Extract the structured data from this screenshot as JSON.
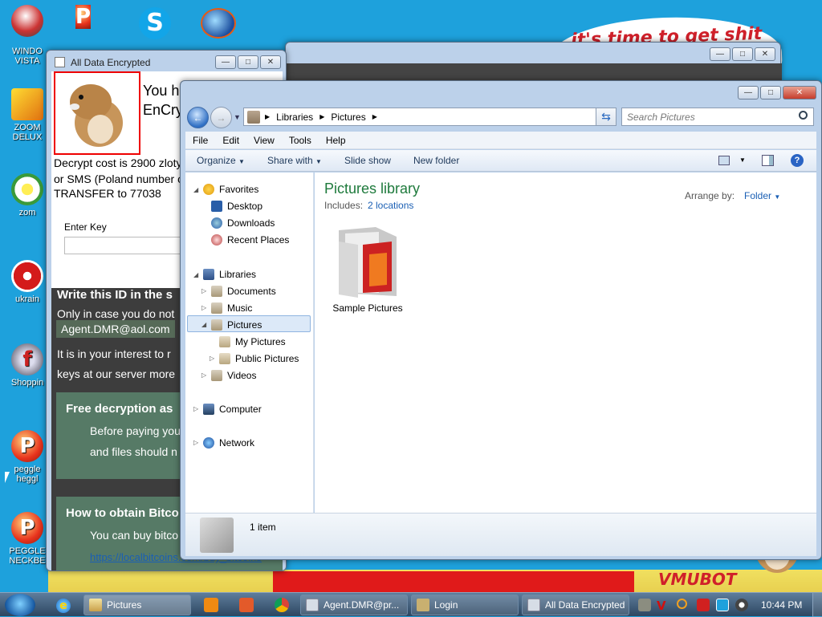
{
  "desktop": {
    "icons": [
      {
        "label": "WINDO\nVISTA"
      },
      {
        "label": "ZOOM\nDELUX"
      },
      {
        "label": "zom"
      },
      {
        "label": "ukrain"
      },
      {
        "label": "Shoppin"
      },
      {
        "label": "peggle\nheggl"
      },
      {
        "label": "PEGGLE\nNECKBE"
      }
    ],
    "wallpaper_top_text": "it's time to get shit",
    "wallpaper_bottom_text": "VMUBOT"
  },
  "ransom": {
    "title": "All Data Encrypted",
    "headline_1": "You h",
    "headline_2": "EnCry",
    "cost_line_1": "Decrypt cost is 2900 zloty",
    "cost_line_2": "or SMS (Poland number o",
    "cost_line_3": "TRANSFER to 77038",
    "key_label": "Enter Key",
    "id_heading": "Write this ID in the s",
    "only_case": "Only in case you do not",
    "email": "Agent.DMR@aol.com",
    "interest_1": "It is in your interest to r",
    "interest_2": "keys at our server more",
    "free_heading": "Free decryption as",
    "free_text_1": "Before paying you",
    "free_text_2": "and files should n",
    "bitcoin_heading": "How to obtain Bitco",
    "bitcoin_text": "You can buy bitco",
    "bitcoin_link": "https://localbitcoins.com/buy_bitcoins"
  },
  "explorer": {
    "breadcrumb": [
      "Libraries",
      "Pictures"
    ],
    "search_placeholder": "Search Pictures",
    "menu": [
      "File",
      "Edit",
      "View",
      "Tools",
      "Help"
    ],
    "commands": [
      "Organize",
      "Share with",
      "Slide show",
      "New folder"
    ],
    "nav": {
      "favorites": "Favorites",
      "desktop": "Desktop",
      "downloads": "Downloads",
      "recent": "Recent Places",
      "libraries": "Libraries",
      "documents": "Documents",
      "music": "Music",
      "pictures": "Pictures",
      "my_pictures": "My Pictures",
      "public_pictures": "Public Pictures",
      "videos": "Videos",
      "computer": "Computer",
      "network": "Network"
    },
    "library_title": "Pictures library",
    "includes_label": "Includes:",
    "includes_link": "2 locations",
    "arrange_label": "Arrange by:",
    "arrange_value": "Folder",
    "items": [
      {
        "name": "Sample Pictures"
      }
    ],
    "status": "1 item"
  },
  "taskbar": {
    "buttons": [
      "Pictures",
      "Agent.DMR@pr...",
      "Login",
      "All Data Encrypted"
    ],
    "clock": "10:44 PM"
  },
  "colors": {
    "desktop": "#1ea1dc",
    "library_title": "#1e7a3c",
    "link": "#1a5fb4",
    "ransom_green": "#567a66",
    "ransom_dark": "#3d3d3d"
  }
}
